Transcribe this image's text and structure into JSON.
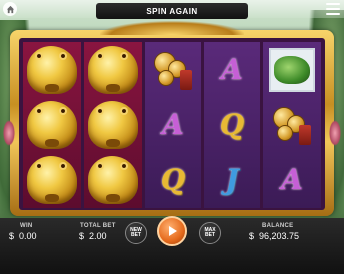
{
  "top_bar": {
    "banner_text": "SPIN AGAIN"
  },
  "reels": [
    [
      "toad",
      "toad",
      "toad"
    ],
    [
      "toad",
      "toad",
      "toad"
    ],
    [
      "coins",
      "A",
      "Q"
    ],
    [
      "A",
      "Q",
      "J"
    ],
    [
      "jade-dragon",
      "coins",
      "A"
    ]
  ],
  "symbols": {
    "A": "A",
    "Q": "Q",
    "J": "J"
  },
  "footer": {
    "win_label": "WIN",
    "win_currency": "$",
    "win_value": "0.00",
    "total_bet_label": "TOTAL BET",
    "total_bet_currency": "$",
    "total_bet_value": "2.00",
    "new_bet_label_1": "NEW",
    "new_bet_label_2": "BET",
    "max_bet_label_1": "MAX",
    "max_bet_label_2": "BET",
    "balance_label": "BALANCE",
    "balance_currency": "$",
    "balance_value": "96,203.75"
  },
  "colors": {
    "frame_gold": "#f1c659",
    "reel_magenta": "#8a1540",
    "reel_purple": "#5a2a7a",
    "spin_orange": "#e56a1c",
    "letter_A": "#c65fd6",
    "letter_Q": "#e8b934",
    "letter_J": "#3f9be0"
  },
  "icons": [
    "home-icon",
    "menu-icon",
    "play-icon"
  ]
}
